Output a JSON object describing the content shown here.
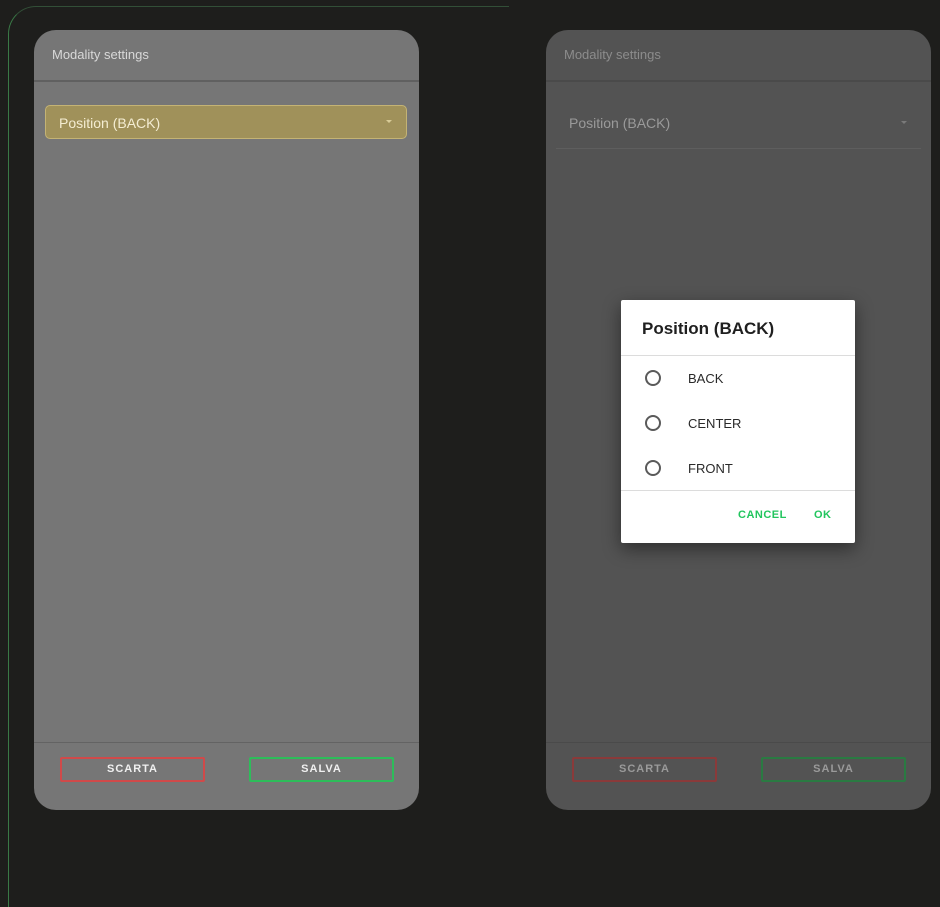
{
  "left_screen": {
    "header": "Modality settings",
    "dropdown_value": "Position (BACK)",
    "discard_label": "SCARTA",
    "save_label": "SALVA"
  },
  "right_screen": {
    "header": "Modality settings",
    "dropdown_value": "Position (BACK)",
    "discard_label": "SCARTA",
    "save_label": "SALVA"
  },
  "dialog": {
    "title": "Position (BACK)",
    "options": [
      {
        "label": "BACK",
        "selected": false
      },
      {
        "label": "CENTER",
        "selected": false
      },
      {
        "label": "FRONT",
        "selected": false
      }
    ],
    "cancel_label": "CANCEL",
    "ok_label": "OK"
  },
  "colors": {
    "accent_green": "#22c55e",
    "discard_red": "#d04a4a",
    "dropdown_highlight": "#a0915a"
  }
}
